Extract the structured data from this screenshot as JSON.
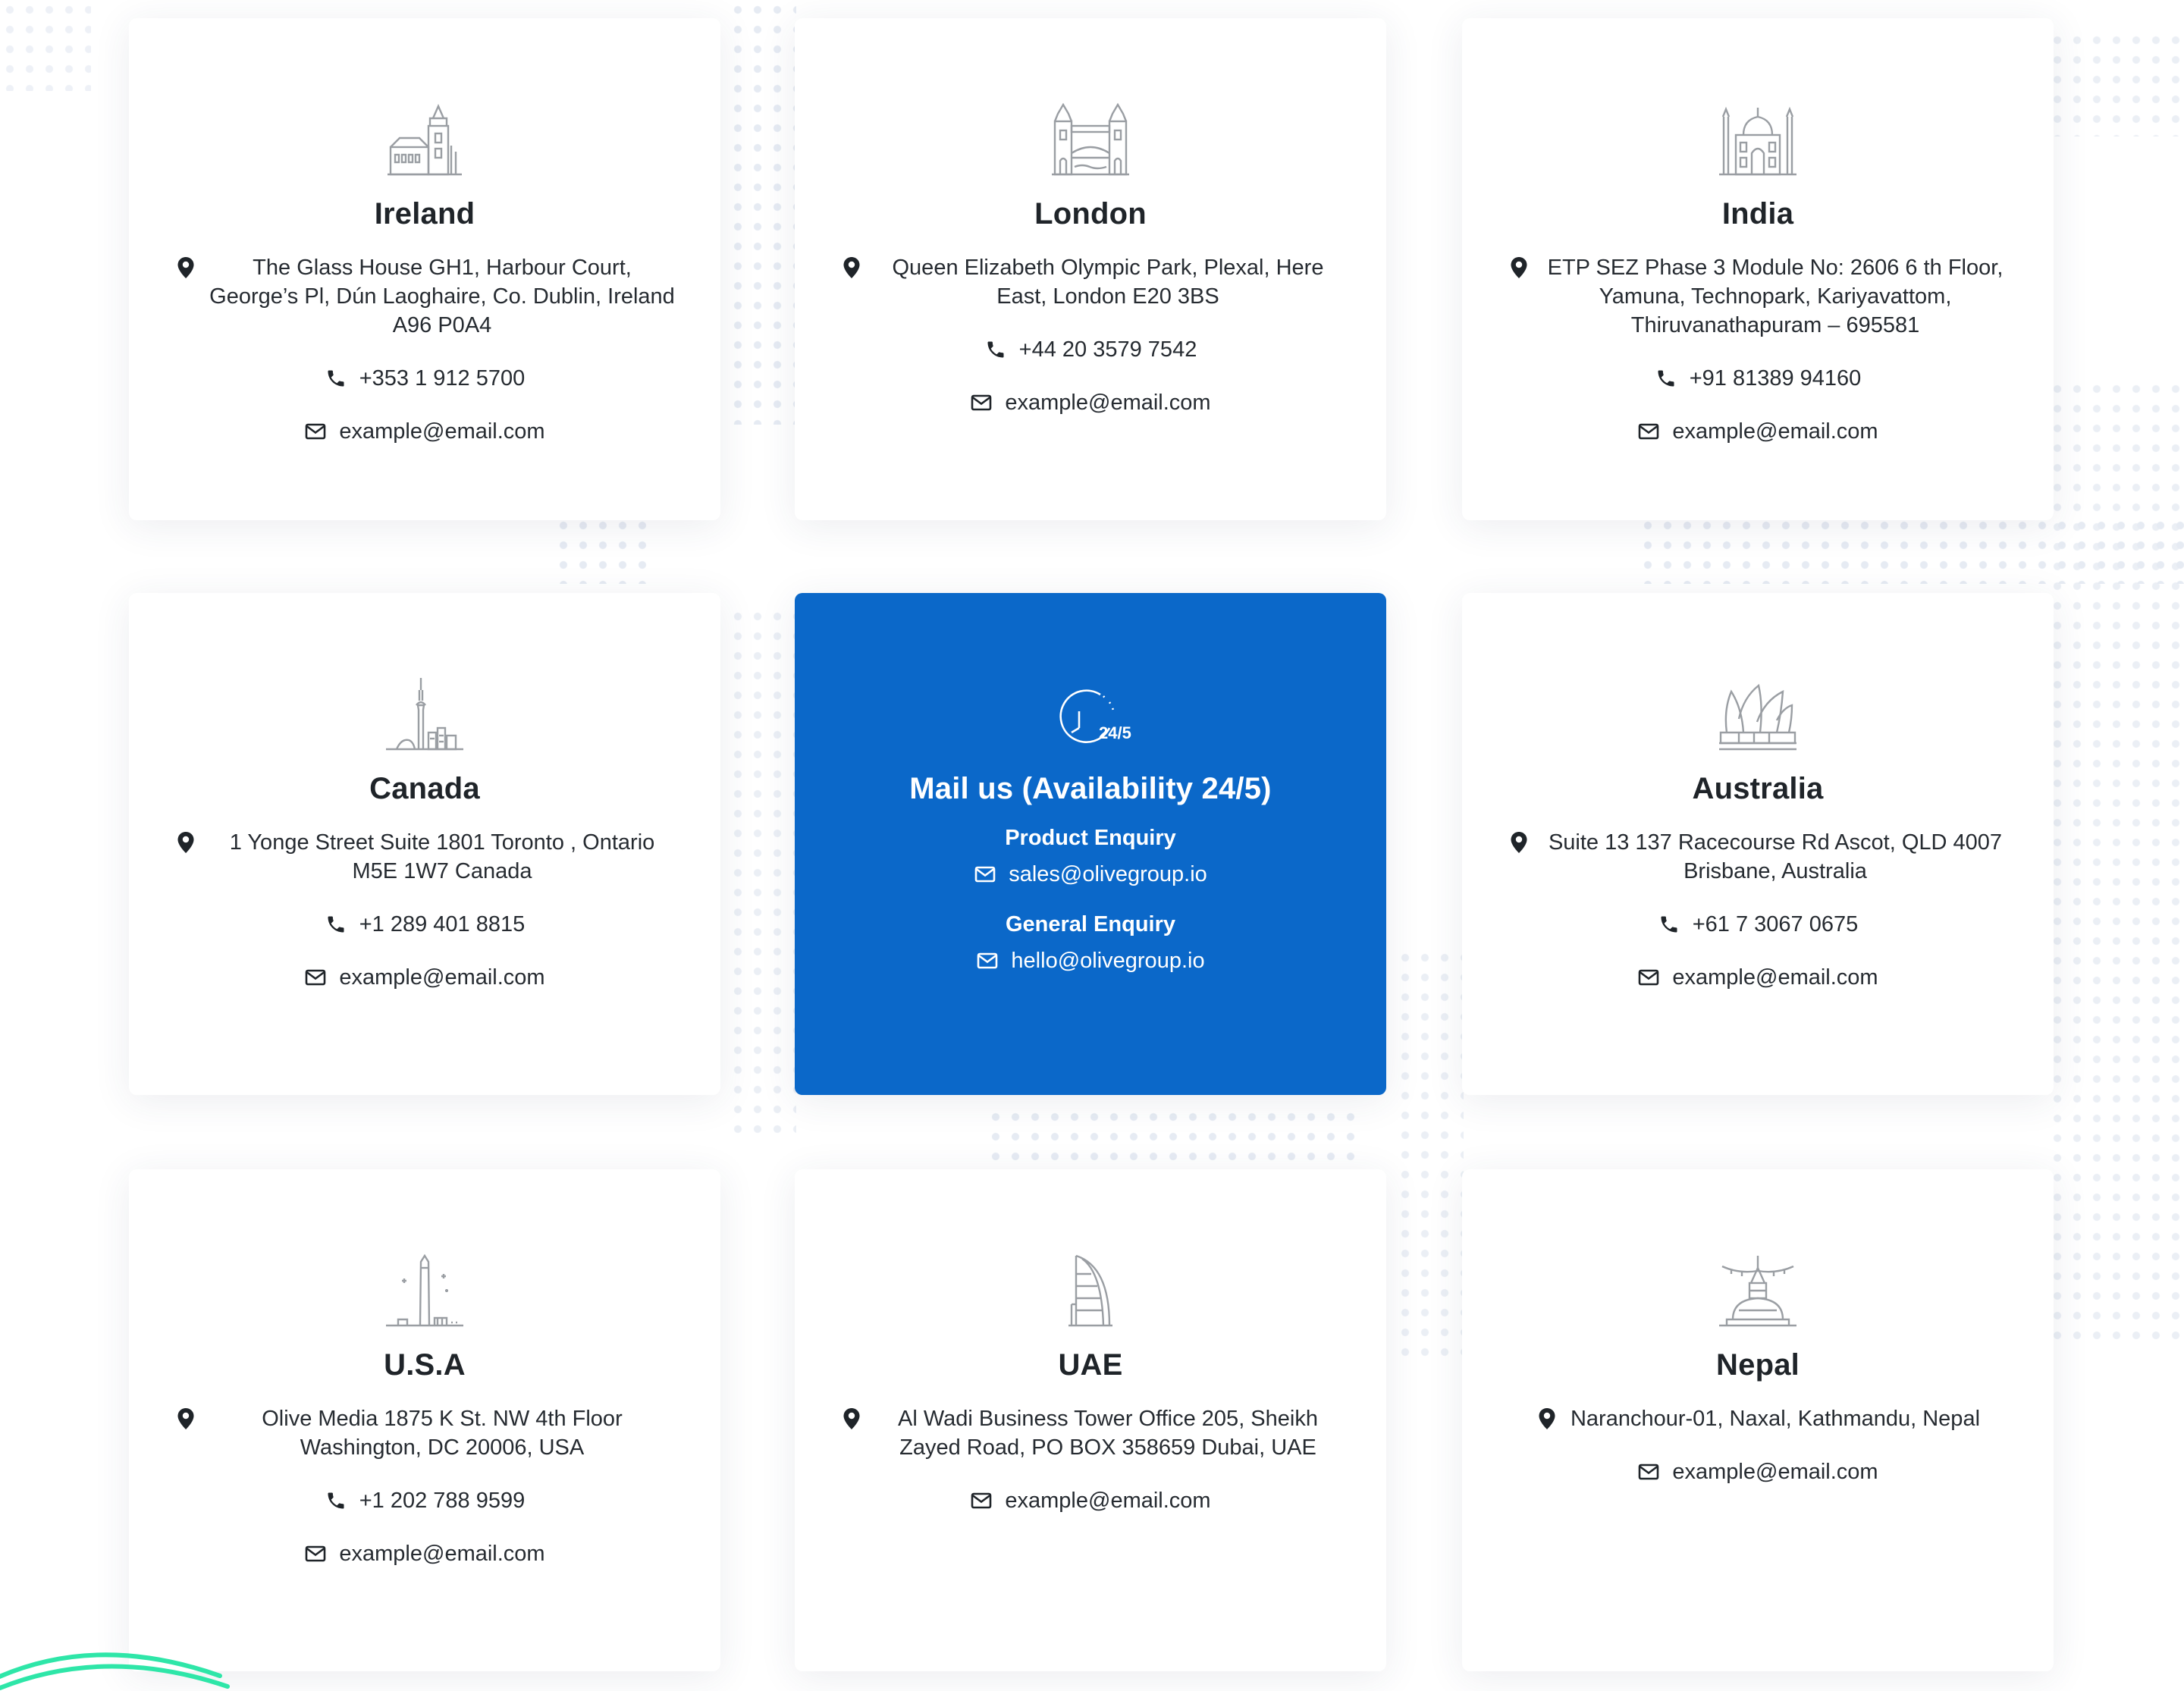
{
  "offices": [
    {
      "name": "Ireland",
      "icon": "castle-landmark-icon",
      "address": "The Glass House GH1, Harbour Court, George’s Pl, Dún Laoghaire, Co. Dublin, Ireland A96 P0A4",
      "phone": "+353 1 912 5700",
      "email": "example@email.com"
    },
    {
      "name": "London",
      "icon": "tower-bridge-icon",
      "address": "Queen Elizabeth Olympic Park, Plexal, Here East, London E20 3BS",
      "phone": "+44 20 3579 7542",
      "email": "example@email.com"
    },
    {
      "name": "India",
      "icon": "taj-mahal-icon",
      "address": "ETP SEZ Phase 3 Module No: 2606 6 th Floor, Yamuna, Technopark, Kariyavattom, Thiruvanathapuram – 695581",
      "phone": "+91 81389 94160",
      "email": "example@email.com"
    },
    {
      "name": "Canada",
      "icon": "cn-tower-icon",
      "address": "1 Yonge Street Suite 1801 Toronto , Ontario M5E 1W7 Canada",
      "phone": "+1 289 401 8815",
      "email": "example@email.com"
    },
    {
      "name": "Australia",
      "icon": "opera-house-icon",
      "address": "Suite 13 137 Racecourse Rd Ascot, QLD 4007 Brisbane, Australia",
      "phone": "+61 7 3067 0675",
      "email": "example@email.com"
    },
    {
      "name": "U.S.A",
      "icon": "washington-monument-icon",
      "address": "Olive Media 1875 K St. NW 4th Floor Washington, DC 20006, USA",
      "phone": "+1 202 788 9599",
      "email": "example@email.com"
    },
    {
      "name": "UAE",
      "icon": "burj-al-arab-icon",
      "address": "Al Wadi Business Tower Office 205, Sheikh Zayed Road, PO BOX 358659 Dubai, UAE",
      "email": "example@email.com"
    },
    {
      "name": "Nepal",
      "icon": "stupa-icon",
      "address": "Naranchour-01, Naxal, Kathmandu, Nepal",
      "email": "example@email.com"
    }
  ],
  "mail_card": {
    "title": "Mail us (Availability 24/5)",
    "icon": "clock-24-5-icon",
    "icon_label": "24/5",
    "product_label": "Product Enquiry",
    "product_email": "sales@olivegroup.io",
    "general_label": "General Enquiry",
    "general_email": "hello@olivegroup.io"
  },
  "colors": {
    "accent": "#0b68c9",
    "card_bg": "#ffffff",
    "text": "#1f2429",
    "icon_gray": "#9a9ea3",
    "swoosh": "#2ee6a8"
  }
}
